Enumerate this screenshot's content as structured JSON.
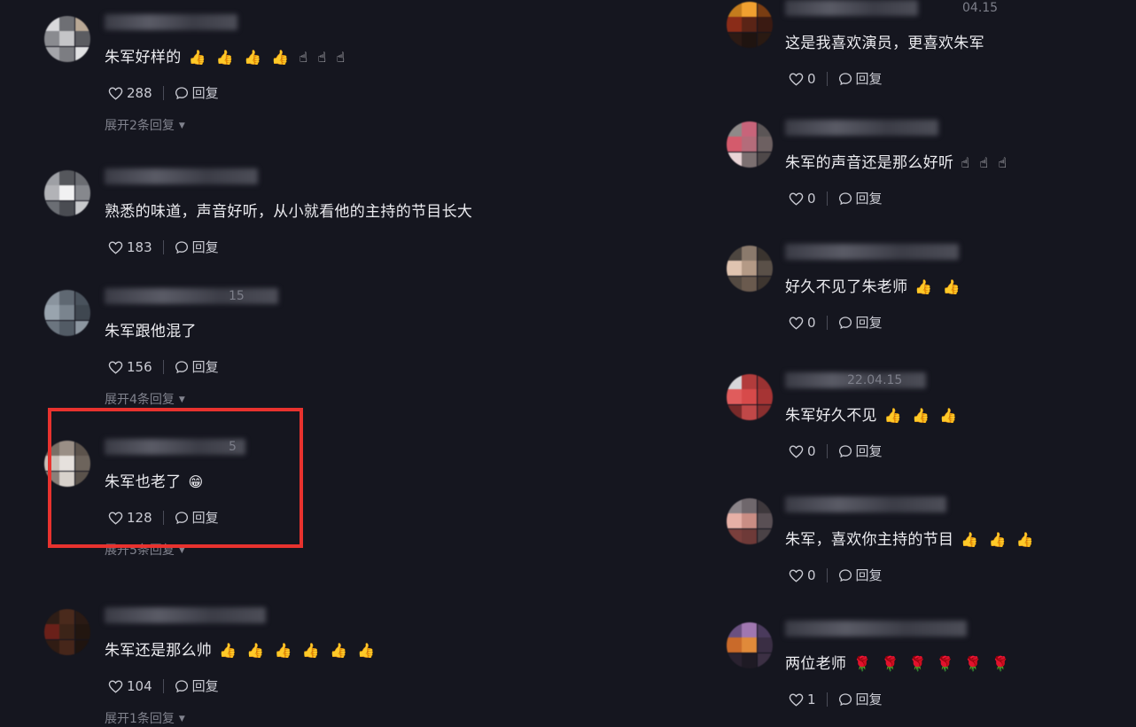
{
  "emoji_glyphs": {
    "thumbs-up": "👍",
    "pointing": "☝",
    "rose": "🌹",
    "grin": "😁"
  },
  "reply_label": "回复",
  "accent_color": "#e8322e",
  "left_comments": [
    {
      "text": "朱军好样的",
      "emoji": [
        "thumbs-up",
        "thumbs-up",
        "thumbs-up",
        "thumbs-up",
        "pointing",
        "pointing",
        "pointing"
      ],
      "likes": "288",
      "expand": "展开2条回复",
      "date": ""
    },
    {
      "text": "熟悉的味道，声音好听，从小就看他的主持的节目长大",
      "emoji": [],
      "likes": "183",
      "expand": "",
      "date": ""
    },
    {
      "text": "朱军跟他混了",
      "emoji": [],
      "likes": "156",
      "expand": "展开4条回复",
      "date": "15"
    },
    {
      "text": "朱军也老了",
      "emoji": [
        "grin"
      ],
      "likes": "128",
      "expand": "展开5条回复",
      "date": "5"
    },
    {
      "text": "朱军还是那么帅",
      "emoji": [
        "thumbs-up",
        "thumbs-up",
        "thumbs-up",
        "thumbs-up",
        "thumbs-up",
        "thumbs-up"
      ],
      "likes": "104",
      "expand": "展开1条回复",
      "date": ""
    }
  ],
  "right_comments": [
    {
      "text": "这是我喜欢演员，更喜欢朱军",
      "emoji": [],
      "likes": "0",
      "date": "04.15"
    },
    {
      "text": "朱军的声音还是那么好听",
      "emoji": [
        "pointing",
        "pointing",
        "pointing"
      ],
      "likes": "0",
      "date": ""
    },
    {
      "text": "好久不见了朱老师",
      "emoji": [
        "thumbs-up",
        "thumbs-up"
      ],
      "likes": "0",
      "date": ""
    },
    {
      "text": "朱军好久不见",
      "emoji": [
        "thumbs-up",
        "thumbs-up",
        "thumbs-up"
      ],
      "likes": "0",
      "date": "22.04.15"
    },
    {
      "text": "朱军，喜欢你主持的节目",
      "emoji": [
        "thumbs-up",
        "thumbs-up",
        "thumbs-up"
      ],
      "likes": "0",
      "date": ""
    },
    {
      "text": "两位老师",
      "emoji": [
        "rose",
        "rose",
        "rose",
        "rose",
        "rose",
        "rose"
      ],
      "likes": "1",
      "date": ""
    }
  ]
}
